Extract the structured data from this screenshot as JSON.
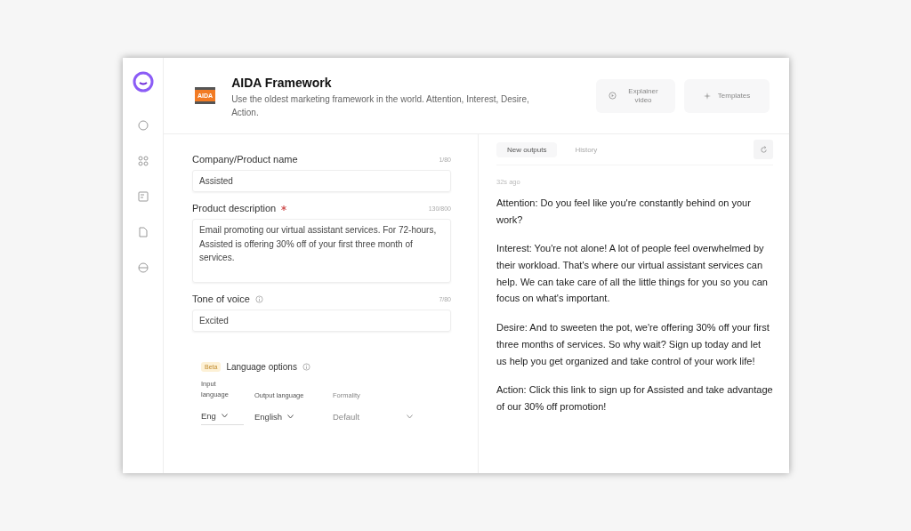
{
  "header": {
    "title": "AIDA Framework",
    "badge": "AIDA",
    "description": "Use the oldest marketing framework in the world. Attention, Interest, Desire, Action.",
    "buttons": [
      {
        "kind": "video",
        "label": "Explainer video"
      },
      {
        "kind": "templates",
        "label": "Templates"
      }
    ]
  },
  "sidebar": {
    "items": [
      {
        "kind": "chat",
        "selected": false
      },
      {
        "kind": "grid",
        "selected": false
      },
      {
        "kind": "doc",
        "selected": false
      },
      {
        "kind": "file",
        "selected": false
      },
      {
        "kind": "db",
        "selected": false
      }
    ]
  },
  "form": {
    "fields": [
      {
        "kind": "input",
        "label": "Company/Product name",
        "required": false,
        "info": false,
        "counter": "1/80",
        "value": "Assisted"
      },
      {
        "kind": "textarea",
        "label": "Product description",
        "required": true,
        "info": false,
        "counter": "130/800",
        "value": "Email promoting our virtual assistant services. For 72-hours, Assisted is offering 30% off of your first three month of services."
      },
      {
        "kind": "input",
        "label": "Tone of voice",
        "required": false,
        "info": true,
        "counter": "7/80",
        "value": "Excited"
      }
    ],
    "language": {
      "badge": "Beta",
      "title": "Language options",
      "selects": [
        {
          "label": "Input language",
          "value": "Eng",
          "disabled": false
        },
        {
          "label": "Output language",
          "value": "English",
          "disabled": false
        },
        {
          "label": "Formality",
          "value": "Default",
          "disabled": true
        }
      ]
    }
  },
  "output": {
    "tabs": [
      {
        "label": "New outputs",
        "selected": true
      },
      {
        "label": "History",
        "selected": false
      }
    ],
    "time": "32s ago",
    "paragraphs": [
      "Attention: Do you feel like you're constantly behind on your work?",
      "Interest: You're not alone! A lot of people feel overwhelmed by their workload. That's where our virtual assistant services can help. We can take care of all the little things for you so you can focus on what's important.",
      "Desire: And to sweeten the pot, we're offering 30% off your first three months of services. So why wait? Sign up today and let us help you get organized and take control of your work life!",
      "Action: Click this link to sign up for Assisted and take advantage of our 30% off promotion!"
    ]
  }
}
